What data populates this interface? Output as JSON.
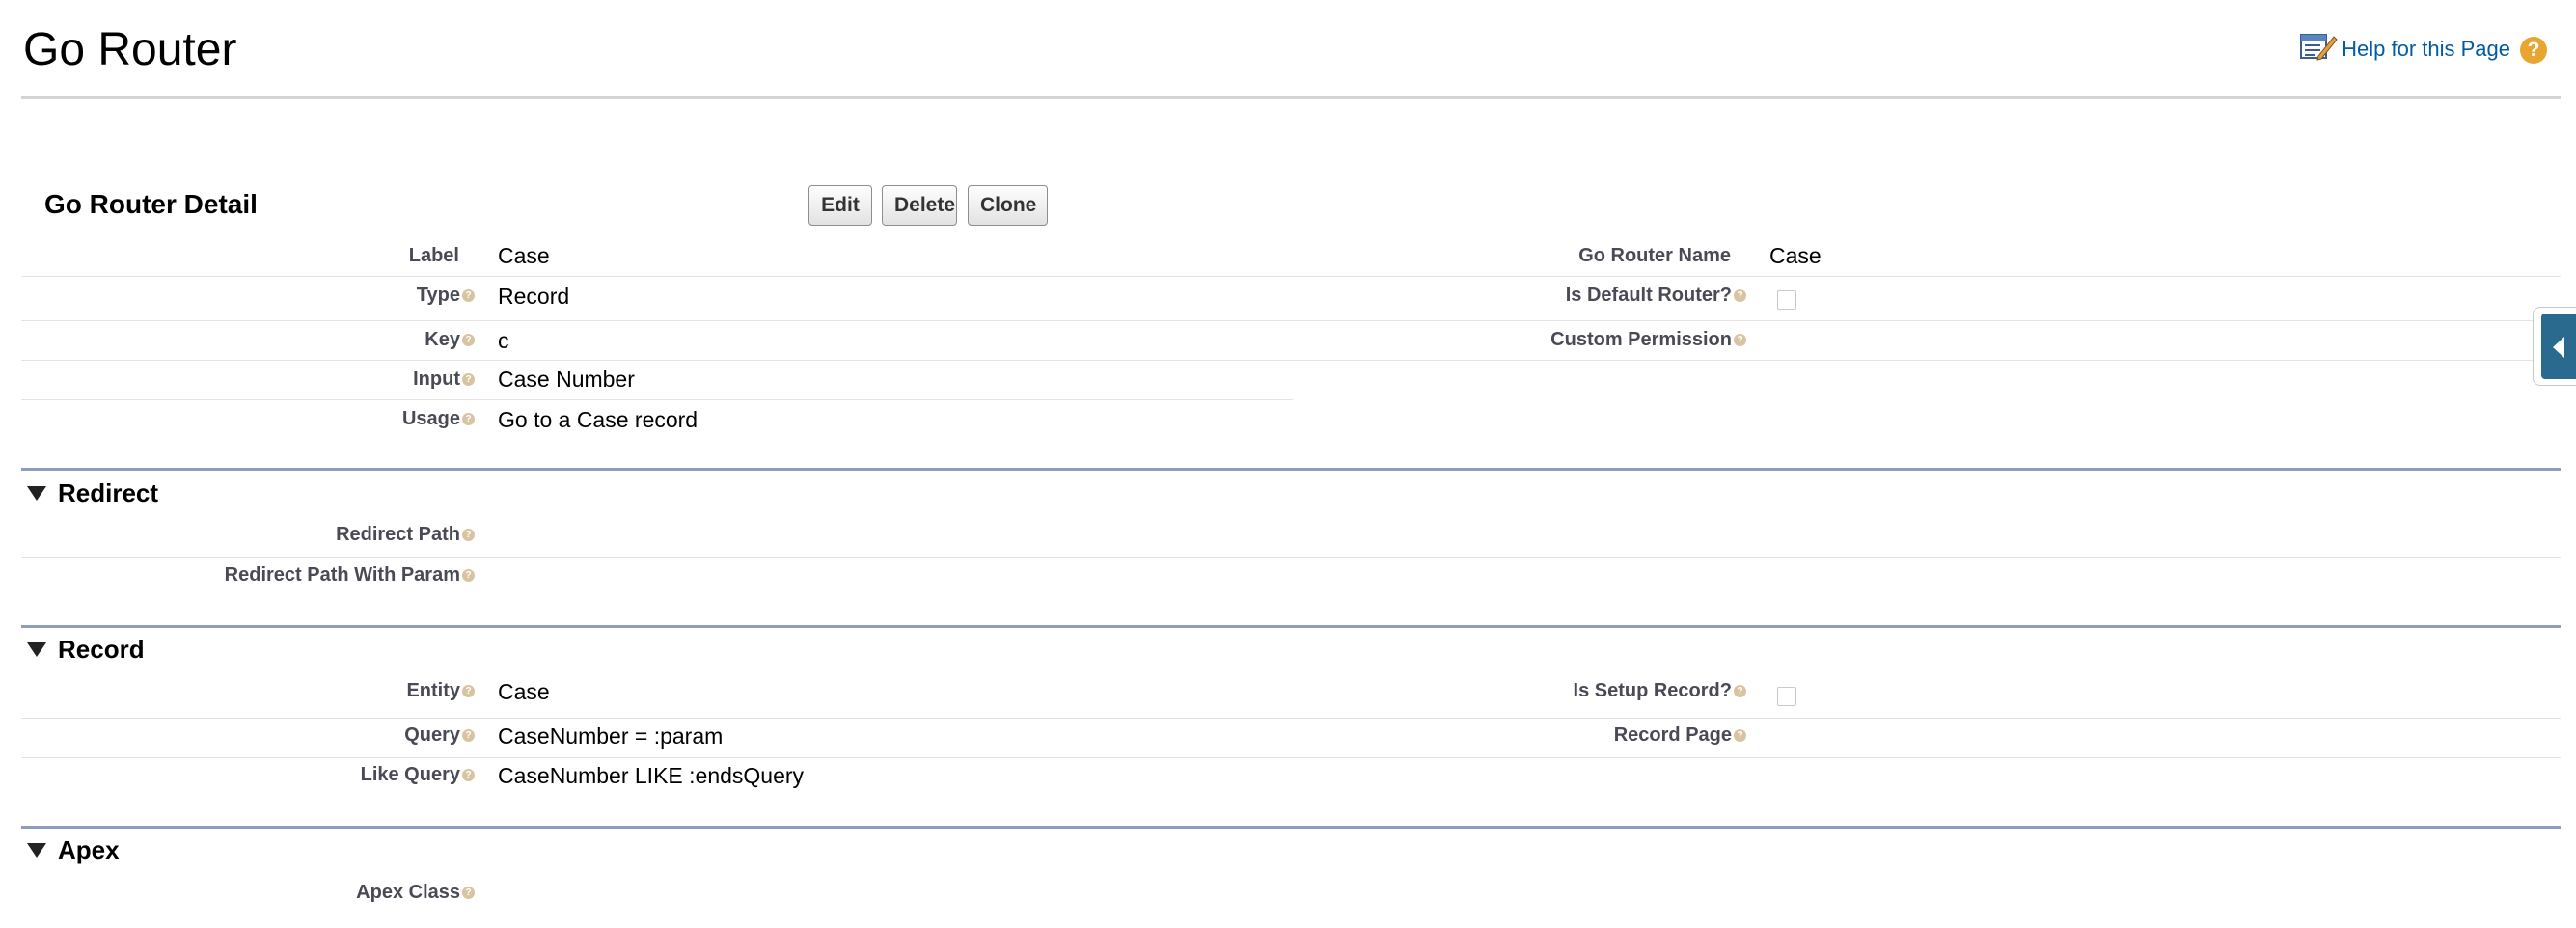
{
  "page": {
    "title": "Go Router"
  },
  "help": {
    "link_text": "Help for this Page",
    "q_glyph": "?"
  },
  "detail": {
    "title": "Go Router Detail",
    "buttons": {
      "edit": "Edit",
      "delete": "Delete",
      "clone": "Clone"
    },
    "left": [
      {
        "label": "Label",
        "value": "Case"
      },
      {
        "label": "Type",
        "value": "Record"
      },
      {
        "label": "Key",
        "value": "c"
      },
      {
        "label": "Input",
        "value": "Case Number"
      },
      {
        "label": "Usage",
        "value": "Go to a Case record"
      }
    ],
    "right": [
      {
        "label": "Go Router Name",
        "value": "Case"
      },
      {
        "label": "Is Default Router?",
        "checked": false
      },
      {
        "label": "Custom Permission",
        "value": ""
      }
    ]
  },
  "redirect": {
    "title": "Redirect",
    "fields": [
      {
        "label": "Redirect Path",
        "value": ""
      },
      {
        "label": "Redirect Path With Param",
        "value": ""
      }
    ]
  },
  "record": {
    "title": "Record",
    "left": [
      {
        "label": "Entity",
        "value": "Case"
      },
      {
        "label": "Query",
        "value": "CaseNumber = :param"
      },
      {
        "label": "Like Query",
        "value": "CaseNumber LIKE :endsQuery"
      }
    ],
    "right": [
      {
        "label": "Is Setup Record?",
        "checked": false
      },
      {
        "label": "Record Page",
        "value": ""
      }
    ]
  },
  "apex": {
    "title": "Apex",
    "fields": [
      {
        "label": "Apex Class",
        "value": ""
      }
    ]
  },
  "colors": {
    "accent_link": "#015ba7",
    "section_rule": "#8e9dbe",
    "help_icon": "#e8a630",
    "side_tab": "#2a6a8e"
  },
  "icons": {
    "help_edit": "edit-page-icon",
    "help_q": "help-circle-icon",
    "section_toggle": "triangle-down-icon",
    "side_tab": "chevron-left-icon"
  }
}
